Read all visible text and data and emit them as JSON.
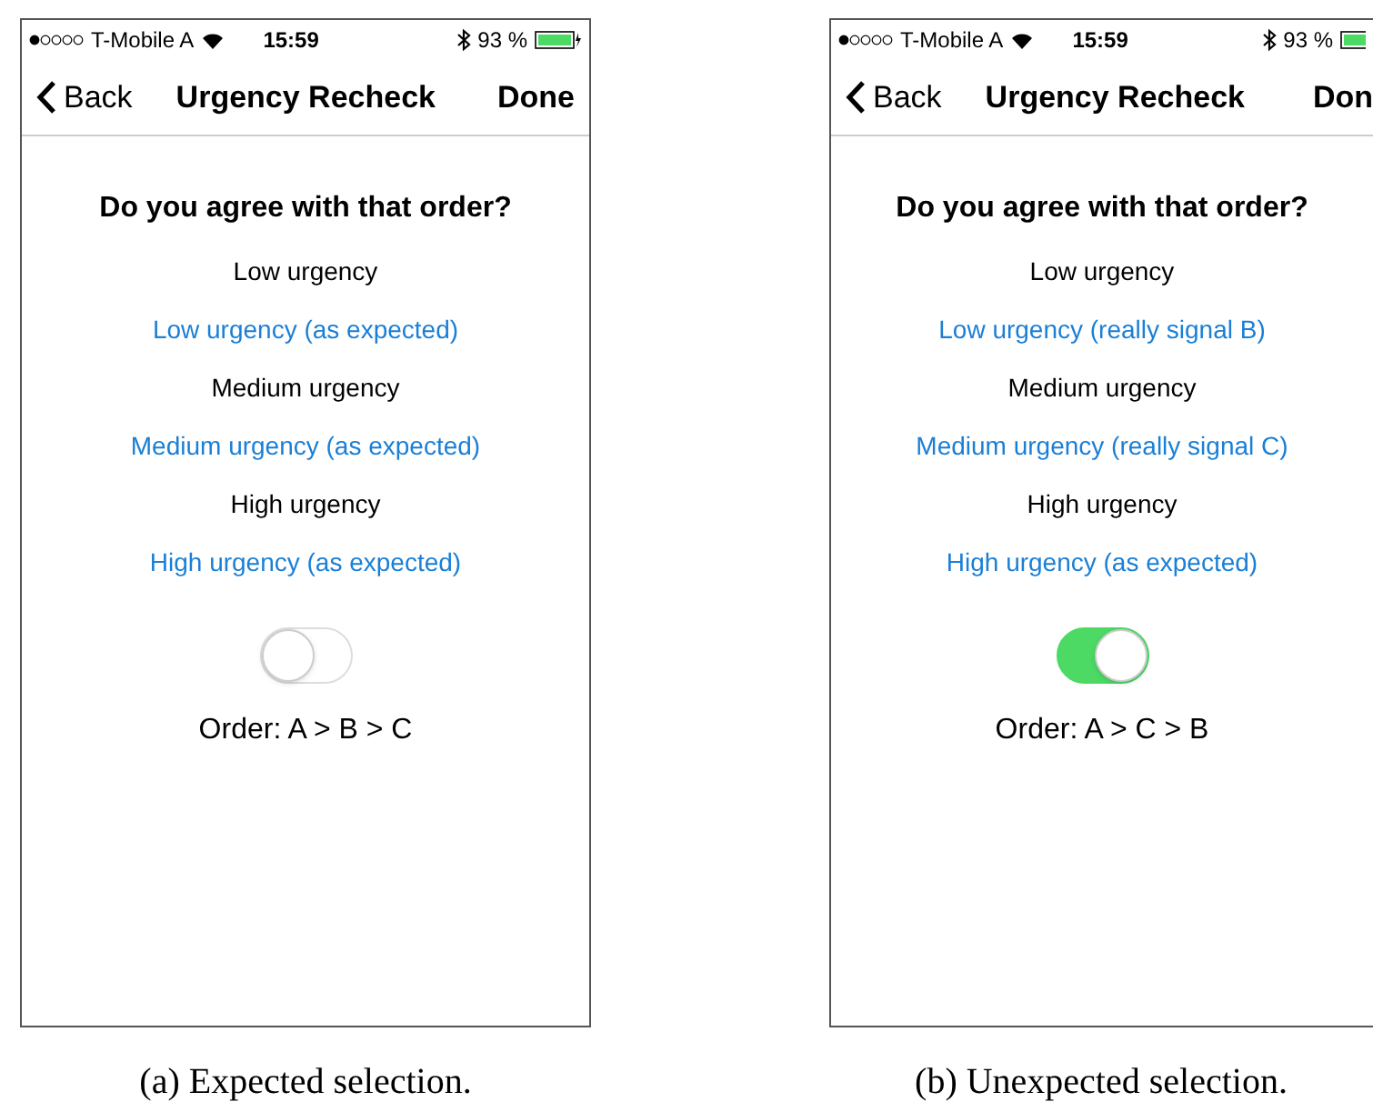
{
  "panels": [
    {
      "status_bar": {
        "carrier": "T-Mobile A",
        "time": "15:59",
        "battery": "93 %"
      },
      "nav": {
        "back": "Back",
        "title": "Urgency Recheck",
        "done": "Done"
      },
      "question": "Do you agree with that order?",
      "groups": [
        {
          "label": "Low urgency",
          "value": "Low urgency (as expected)"
        },
        {
          "label": "Medium urgency",
          "value": "Medium urgency (as expected)"
        },
        {
          "label": "High urgency",
          "value": "High urgency (as expected)"
        }
      ],
      "toggle": {
        "on": false
      },
      "order": "Order: A > B > C",
      "caption": "(a) Expected selection."
    },
    {
      "status_bar": {
        "carrier": "T-Mobile A",
        "time": "15:59",
        "battery": "93 %"
      },
      "nav": {
        "back": "Back",
        "title": "Urgency Recheck",
        "done": "Don"
      },
      "question": "Do you agree with that order?",
      "groups": [
        {
          "label": "Low urgency",
          "value": "Low urgency (really signal B)"
        },
        {
          "label": "Medium urgency",
          "value": "Medium urgency (really signal C)"
        },
        {
          "label": "High urgency",
          "value": "High urgency (as expected)"
        }
      ],
      "toggle": {
        "on": true
      },
      "order": "Order: A > C > B",
      "caption": "(b) Unexpected selection."
    }
  ]
}
